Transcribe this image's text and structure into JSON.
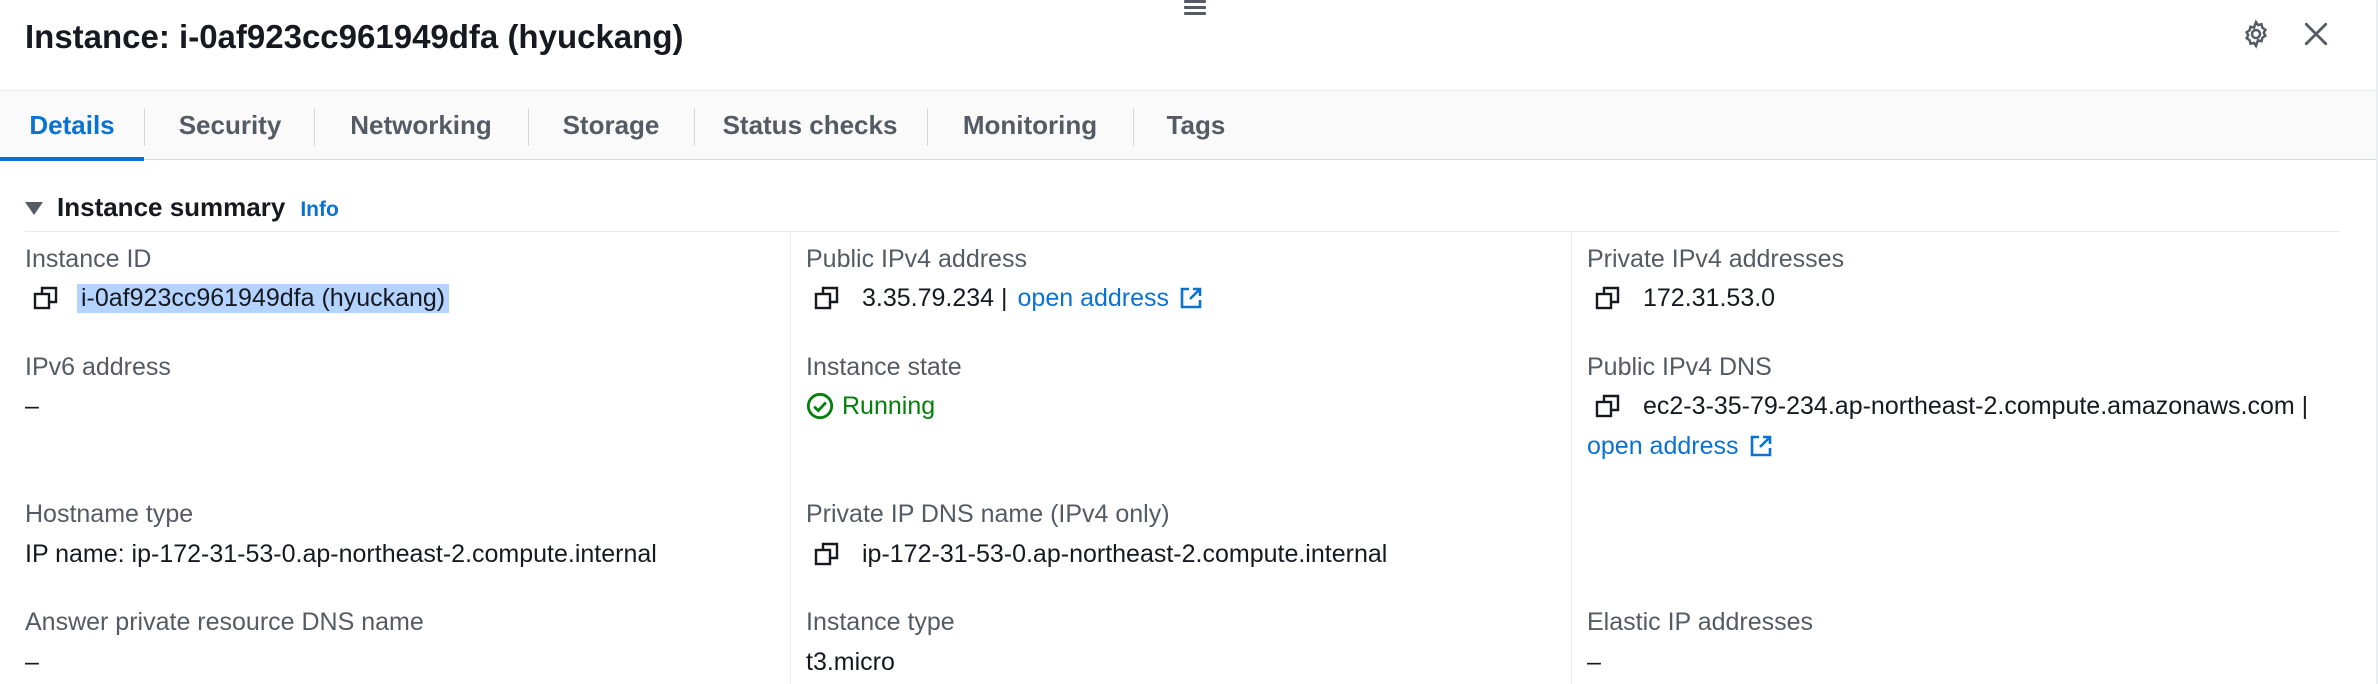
{
  "header": {
    "title": "Instance: i-0af923cc961949dfa (hyuckang)",
    "icons": {
      "drag": "drag-handle-icon",
      "settings": "gear-icon",
      "close": "close-icon"
    }
  },
  "tabs": [
    {
      "label": "Details",
      "active": true
    },
    {
      "label": "Security",
      "active": false
    },
    {
      "label": "Networking",
      "active": false
    },
    {
      "label": "Storage",
      "active": false
    },
    {
      "label": "Status checks",
      "active": false
    },
    {
      "label": "Monitoring",
      "active": false
    },
    {
      "label": "Tags",
      "active": false
    }
  ],
  "summary": {
    "title": "Instance summary",
    "info_label": "Info",
    "fields": {
      "instance_id": {
        "label": "Instance ID",
        "value": "i-0af923cc961949dfa (hyuckang)"
      },
      "public_ipv4": {
        "label": "Public IPv4 address",
        "value": "3.35.79.234 |",
        "link": "open address"
      },
      "private_ipv4": {
        "label": "Private IPv4 addresses",
        "value": "172.31.53.0"
      },
      "ipv6": {
        "label": "IPv6 address",
        "value": "–"
      },
      "instance_state": {
        "label": "Instance state",
        "value": "Running"
      },
      "public_dns": {
        "label": "Public IPv4 DNS",
        "value": "ec2-3-35-79-234.ap-northeast-2.compute.amazonaws.com |",
        "link": "open address"
      },
      "hostname_type": {
        "label": "Hostname type",
        "value": "IP name: ip-172-31-53-0.ap-northeast-2.compute.internal"
      },
      "private_dns": {
        "label": "Private IP DNS name (IPv4 only)",
        "value": "ip-172-31-53-0.ap-northeast-2.compute.internal"
      },
      "answer_dns": {
        "label": "Answer private resource DNS name",
        "value": "–"
      },
      "instance_type": {
        "label": "Instance type",
        "value": "t3.micro"
      },
      "elastic_ip": {
        "label": "Elastic IP addresses",
        "value": "–"
      }
    }
  },
  "colors": {
    "link": "#0972d3",
    "success": "#037f0c",
    "label": "#545b64",
    "text": "#16191f",
    "selection": "#b4d4ff"
  }
}
